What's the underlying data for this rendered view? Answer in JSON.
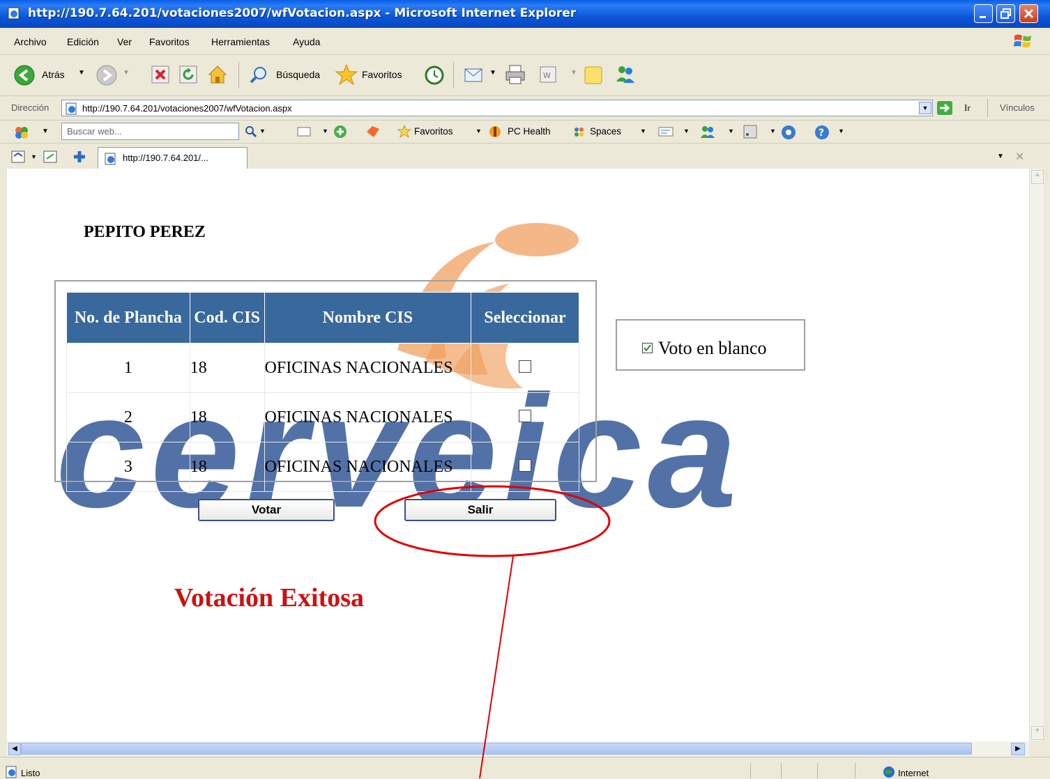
{
  "window": {
    "title": "http://190.7.64.201/votaciones2007/wfVotacion.aspx - Microsoft Internet Explorer"
  },
  "menu": [
    "Archivo",
    "Edición",
    "Ver",
    "Favoritos",
    "Herramientas",
    "Ayuda"
  ],
  "toolbar": {
    "back_label": "Atrás",
    "search_label": "Búsqueda",
    "favorites_label": "Favoritos"
  },
  "address": {
    "label": "Dirección",
    "url": "http://190.7.64.201/votaciones2007/wfVotacion.aspx",
    "go_label": "Ir",
    "links_label": "Vínculos"
  },
  "search_toolbar": {
    "placeholder": "Buscar web...",
    "favorites_label": "Favoritos",
    "pchealth_label": "PC Health",
    "spaces_label": "Spaces"
  },
  "tab": {
    "label": "http://190.7.64.201/..."
  },
  "page": {
    "user_name": "PEPITO PEREZ",
    "table": {
      "headers": [
        "No. de Plancha",
        "Cod. CIS",
        "Nombre CIS",
        "Seleccionar"
      ],
      "rows": [
        {
          "plancha": "1",
          "cod": "18",
          "nombre": "OFICINAS NACIONALES",
          "selected": false
        },
        {
          "plancha": "2",
          "cod": "18",
          "nombre": "OFICINAS NACIONALES",
          "selected": false
        },
        {
          "plancha": "3",
          "cod": "18",
          "nombre": "OFICINAS NACIONALES",
          "selected": false
        }
      ]
    },
    "blank_vote": {
      "label": "Voto en blanco",
      "checked": true
    },
    "vote_button": "Votar",
    "exit_button": "Salir",
    "success_message": "Votación Exitosa",
    "watermark_text": "cerveica"
  },
  "status": {
    "text": "Listo",
    "zone": "Internet"
  },
  "colors": {
    "table_header": "#39689c",
    "success": "#cc1111",
    "annotation": "#e00000",
    "logo_blue": "#4466a0",
    "logo_orange": "#f0a060"
  }
}
